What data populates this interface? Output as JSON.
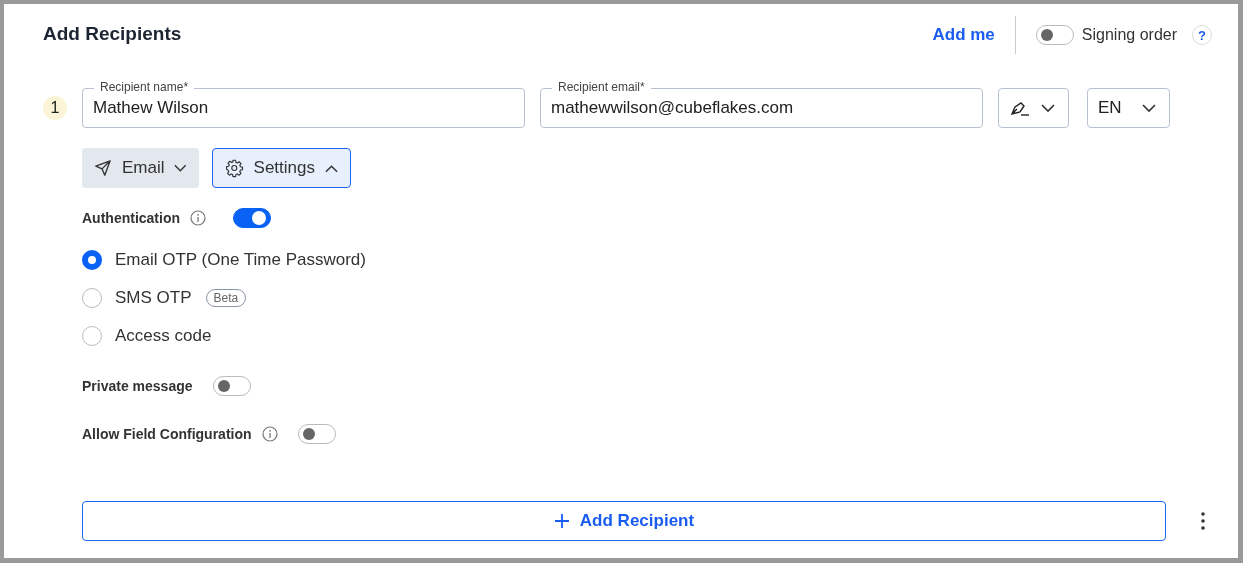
{
  "header": {
    "title": "Add Recipients",
    "add_me": "Add me",
    "signing_order": {
      "label": "Signing order",
      "on": false
    },
    "help": "?"
  },
  "recipients": [
    {
      "number": "1",
      "name": {
        "label": "Recipient name*",
        "value": "Mathew Wilson"
      },
      "email": {
        "label": "Recipient email*",
        "value": "mathewwilson@cubeflakes.com"
      },
      "language": "EN",
      "delivery": "Email",
      "settings": {
        "label": "Settings",
        "expanded": true
      },
      "authentication": {
        "label": "Authentication",
        "on": true,
        "options": [
          {
            "label": "Email OTP (One Time Password)",
            "selected": true
          },
          {
            "label": "SMS OTP",
            "badge": "Beta",
            "selected": false
          },
          {
            "label": "Access code",
            "selected": false
          }
        ]
      },
      "private_message": {
        "label": "Private message",
        "on": false
      },
      "allow_field_configuration": {
        "label": "Allow Field Configuration",
        "on": false
      }
    }
  ],
  "add_recipient": "Add Recipient"
}
